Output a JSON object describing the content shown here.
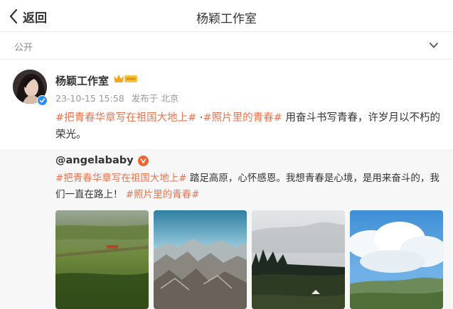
{
  "header": {
    "back_label": "返回",
    "title": "杨颖工作室",
    "back_icon": "chevron-left-icon"
  },
  "visibility": {
    "label": "公开",
    "icon": "chevron-down-icon"
  },
  "author": {
    "name": "杨颖工作室",
    "timestamp": "23-10-15 15:58",
    "source": "发布于 北京",
    "badges": [
      "verified-icon",
      "crown-level-icon"
    ]
  },
  "post": {
    "tag1": "#把青春华章写在祖国大地上#",
    "separator": " ·",
    "tag2": "#照片里的青春#",
    "text": " 用奋斗书写青春，许岁月以不朽的荣光。"
  },
  "repost": {
    "user": "@angelababy",
    "tag1": "#把青春华章写在祖国大地上#",
    "text": " 踏足高原，心怀感恩。我想青春是心境，是用来奋斗的，我们一直在路上！ ",
    "tag2": "#照片里的青春#",
    "photos": [
      {
        "name": "photo-green-hills-road"
      },
      {
        "name": "photo-aerial-mountains"
      },
      {
        "name": "photo-forest-tent"
      },
      {
        "name": "photo-blue-sky-clouds"
      }
    ]
  },
  "colors": {
    "tag": "#eb7350",
    "verified_blue": "#2b8ff5",
    "v_orange": "#f06430"
  }
}
